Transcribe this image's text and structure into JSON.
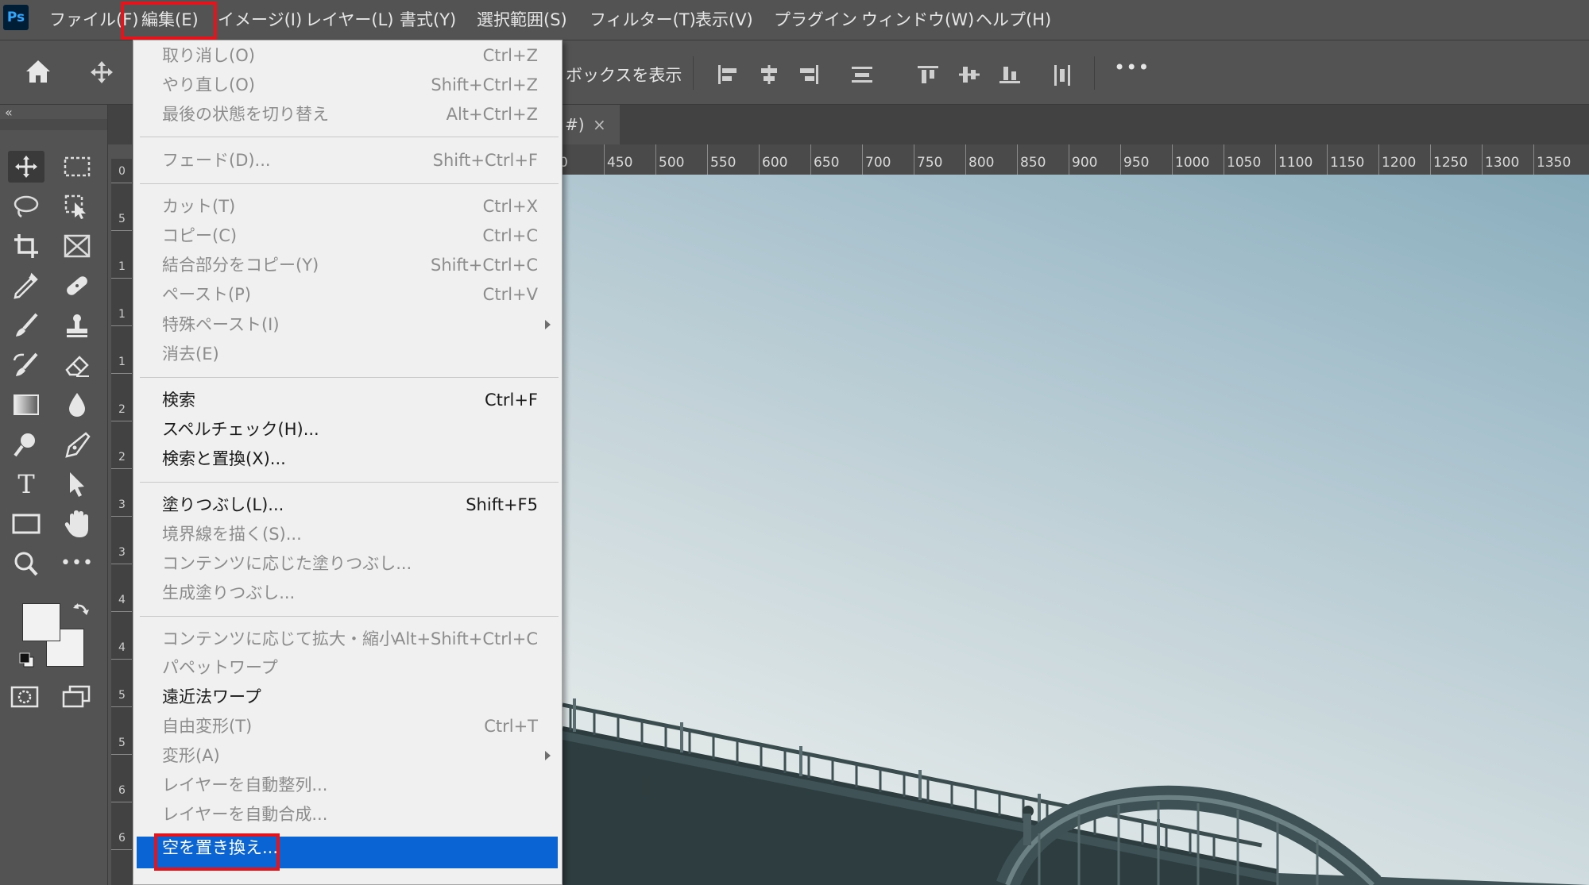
{
  "app": {
    "logo": "Ps"
  },
  "menubar": {
    "items": [
      {
        "label": "ファイル(F)"
      },
      {
        "label": "編集(E)"
      },
      {
        "label": "イメージ(I)"
      },
      {
        "label": "レイヤー(L)"
      },
      {
        "label": "書式(Y)"
      },
      {
        "label": "選択範囲(S)"
      },
      {
        "label": "フィルター(T)"
      },
      {
        "label": "表示(V)"
      },
      {
        "label": "プラグイン"
      },
      {
        "label": "ウィンドウ(W)"
      },
      {
        "label": "ヘルプ(H)"
      }
    ],
    "active": "編集(E)"
  },
  "options_bar": {
    "show_box_label": "ボックスを表示",
    "more_label": "•••"
  },
  "document_tab": {
    "label_fragment": "#)",
    "close_glyph": "×"
  },
  "ruler_top": {
    "labels": [
      "0",
      "450",
      "500",
      "550",
      "600",
      "650",
      "700",
      "750",
      "800",
      "850",
      "900",
      "950",
      "1000",
      "1050",
      "1100",
      "1150",
      "1200",
      "1250",
      "1300",
      "1350"
    ]
  },
  "ruler_left": {
    "labels": [
      "0",
      "5",
      "1",
      "1",
      "1",
      "2",
      "2",
      "3",
      "3",
      "4",
      "4",
      "5",
      "5",
      "6",
      "6"
    ]
  },
  "toolbar": {
    "collapse_glyph": "«",
    "tools": [
      "move-icon",
      "marquee-icon",
      "lasso-icon",
      "object-select-icon",
      "crop-icon",
      "frame-icon",
      "eyedropper-icon",
      "healing-brush-icon",
      "brush-icon",
      "stamp-icon",
      "history-brush-icon",
      "eraser-icon",
      "gradient-icon",
      "blur-icon",
      "dodge-icon",
      "pen-icon",
      "type-icon",
      "path-select-icon",
      "rectangle-icon",
      "hand-icon",
      "zoom-icon",
      "more-tools-icon"
    ],
    "type_glyph": "T",
    "more_glyph": "•••"
  },
  "edit_menu": {
    "groups": [
      [
        {
          "label": "取り消し(O)",
          "shortcut": "Ctrl+Z",
          "enabled": false
        },
        {
          "label": "やり直し(O)",
          "shortcut": "Shift+Ctrl+Z",
          "enabled": false
        },
        {
          "label": "最後の状態を切り替え",
          "shortcut": "Alt+Ctrl+Z",
          "enabled": false
        }
      ],
      [
        {
          "label": "フェード(D)...",
          "shortcut": "Shift+Ctrl+F",
          "enabled": false
        }
      ],
      [
        {
          "label": "カット(T)",
          "shortcut": "Ctrl+X",
          "enabled": false
        },
        {
          "label": "コピー(C)",
          "shortcut": "Ctrl+C",
          "enabled": false
        },
        {
          "label": "結合部分をコピー(Y)",
          "shortcut": "Shift+Ctrl+C",
          "enabled": false
        },
        {
          "label": "ペースト(P)",
          "shortcut": "Ctrl+V",
          "enabled": false
        },
        {
          "label": "特殊ペースト(I)",
          "shortcut": "",
          "enabled": false,
          "submenu": true
        },
        {
          "label": "消去(E)",
          "shortcut": "",
          "enabled": false
        }
      ],
      [
        {
          "label": "検索",
          "shortcut": "Ctrl+F",
          "enabled": true
        },
        {
          "label": "スペルチェック(H)...",
          "shortcut": "",
          "enabled": true
        },
        {
          "label": "検索と置換(X)...",
          "shortcut": "",
          "enabled": true
        }
      ],
      [
        {
          "label": "塗りつぶし(L)...",
          "shortcut": "Shift+F5",
          "enabled": true
        },
        {
          "label": "境界線を描く(S)...",
          "shortcut": "",
          "enabled": false
        },
        {
          "label": "コンテンツに応じた塗りつぶし...",
          "shortcut": "",
          "enabled": false
        },
        {
          "label": "生成塗りつぶし...",
          "shortcut": "",
          "enabled": false
        }
      ],
      [
        {
          "label": "コンテンツに応じて拡大・縮小",
          "shortcut": "Alt+Shift+Ctrl+C",
          "enabled": false
        },
        {
          "label": "パペットワープ",
          "shortcut": "",
          "enabled": false
        },
        {
          "label": "遠近法ワープ",
          "shortcut": "",
          "enabled": true
        },
        {
          "label": "自由変形(T)",
          "shortcut": "Ctrl+T",
          "enabled": false
        },
        {
          "label": "変形(A)",
          "shortcut": "",
          "enabled": false,
          "submenu": true
        },
        {
          "label": "レイヤーを自動整列...",
          "shortcut": "",
          "enabled": false
        },
        {
          "label": "レイヤーを自動合成...",
          "shortcut": "",
          "enabled": false
        },
        {
          "label": "空を置き換え...",
          "shortcut": "",
          "enabled": true,
          "selected": true
        }
      ]
    ]
  },
  "colors": {
    "menu_bg": "#f0f0f0",
    "selection": "#0a64d3",
    "callout": "#e4141c",
    "chrome": "#535353"
  }
}
